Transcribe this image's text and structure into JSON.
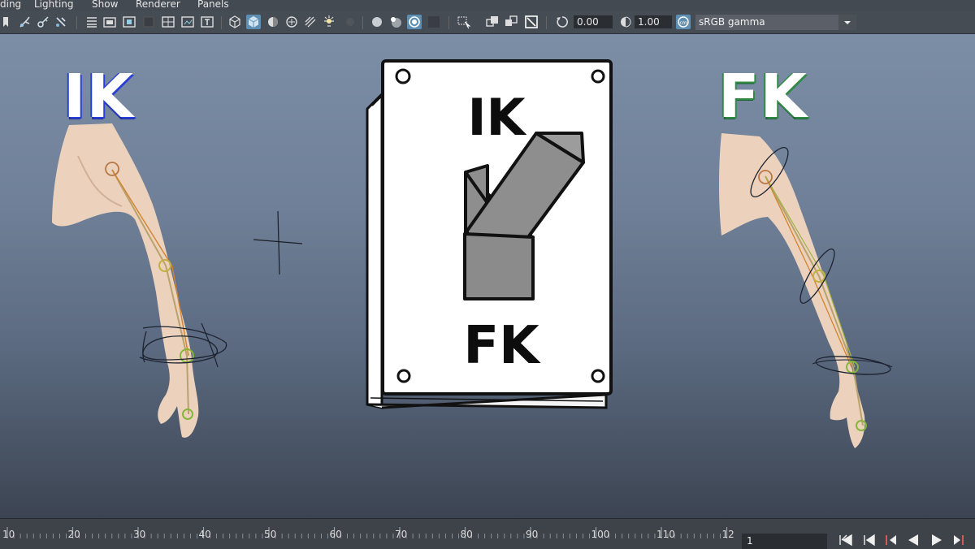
{
  "menu": [
    "ding",
    "Lighting",
    "Show",
    "Renderer",
    "Panels"
  ],
  "toolbar": {
    "exposure_value": "0.00",
    "gamma_value": "1.00",
    "colorspace": "sRGB gamma"
  },
  "labels": {
    "left_mode": "IK",
    "right_mode": "FK",
    "switch_top": "IK",
    "switch_bottom": "FK"
  },
  "timeline": {
    "ticks": [
      "10",
      "20",
      "30",
      "40",
      "50",
      "60",
      "70",
      "80",
      "90",
      "100",
      "110",
      "12"
    ],
    "current_frame": "1"
  },
  "colors": {
    "ik_outline": "#2a3fd6",
    "fk_outline": "#2f8a45",
    "selected_icon": "#5d8fb5"
  }
}
